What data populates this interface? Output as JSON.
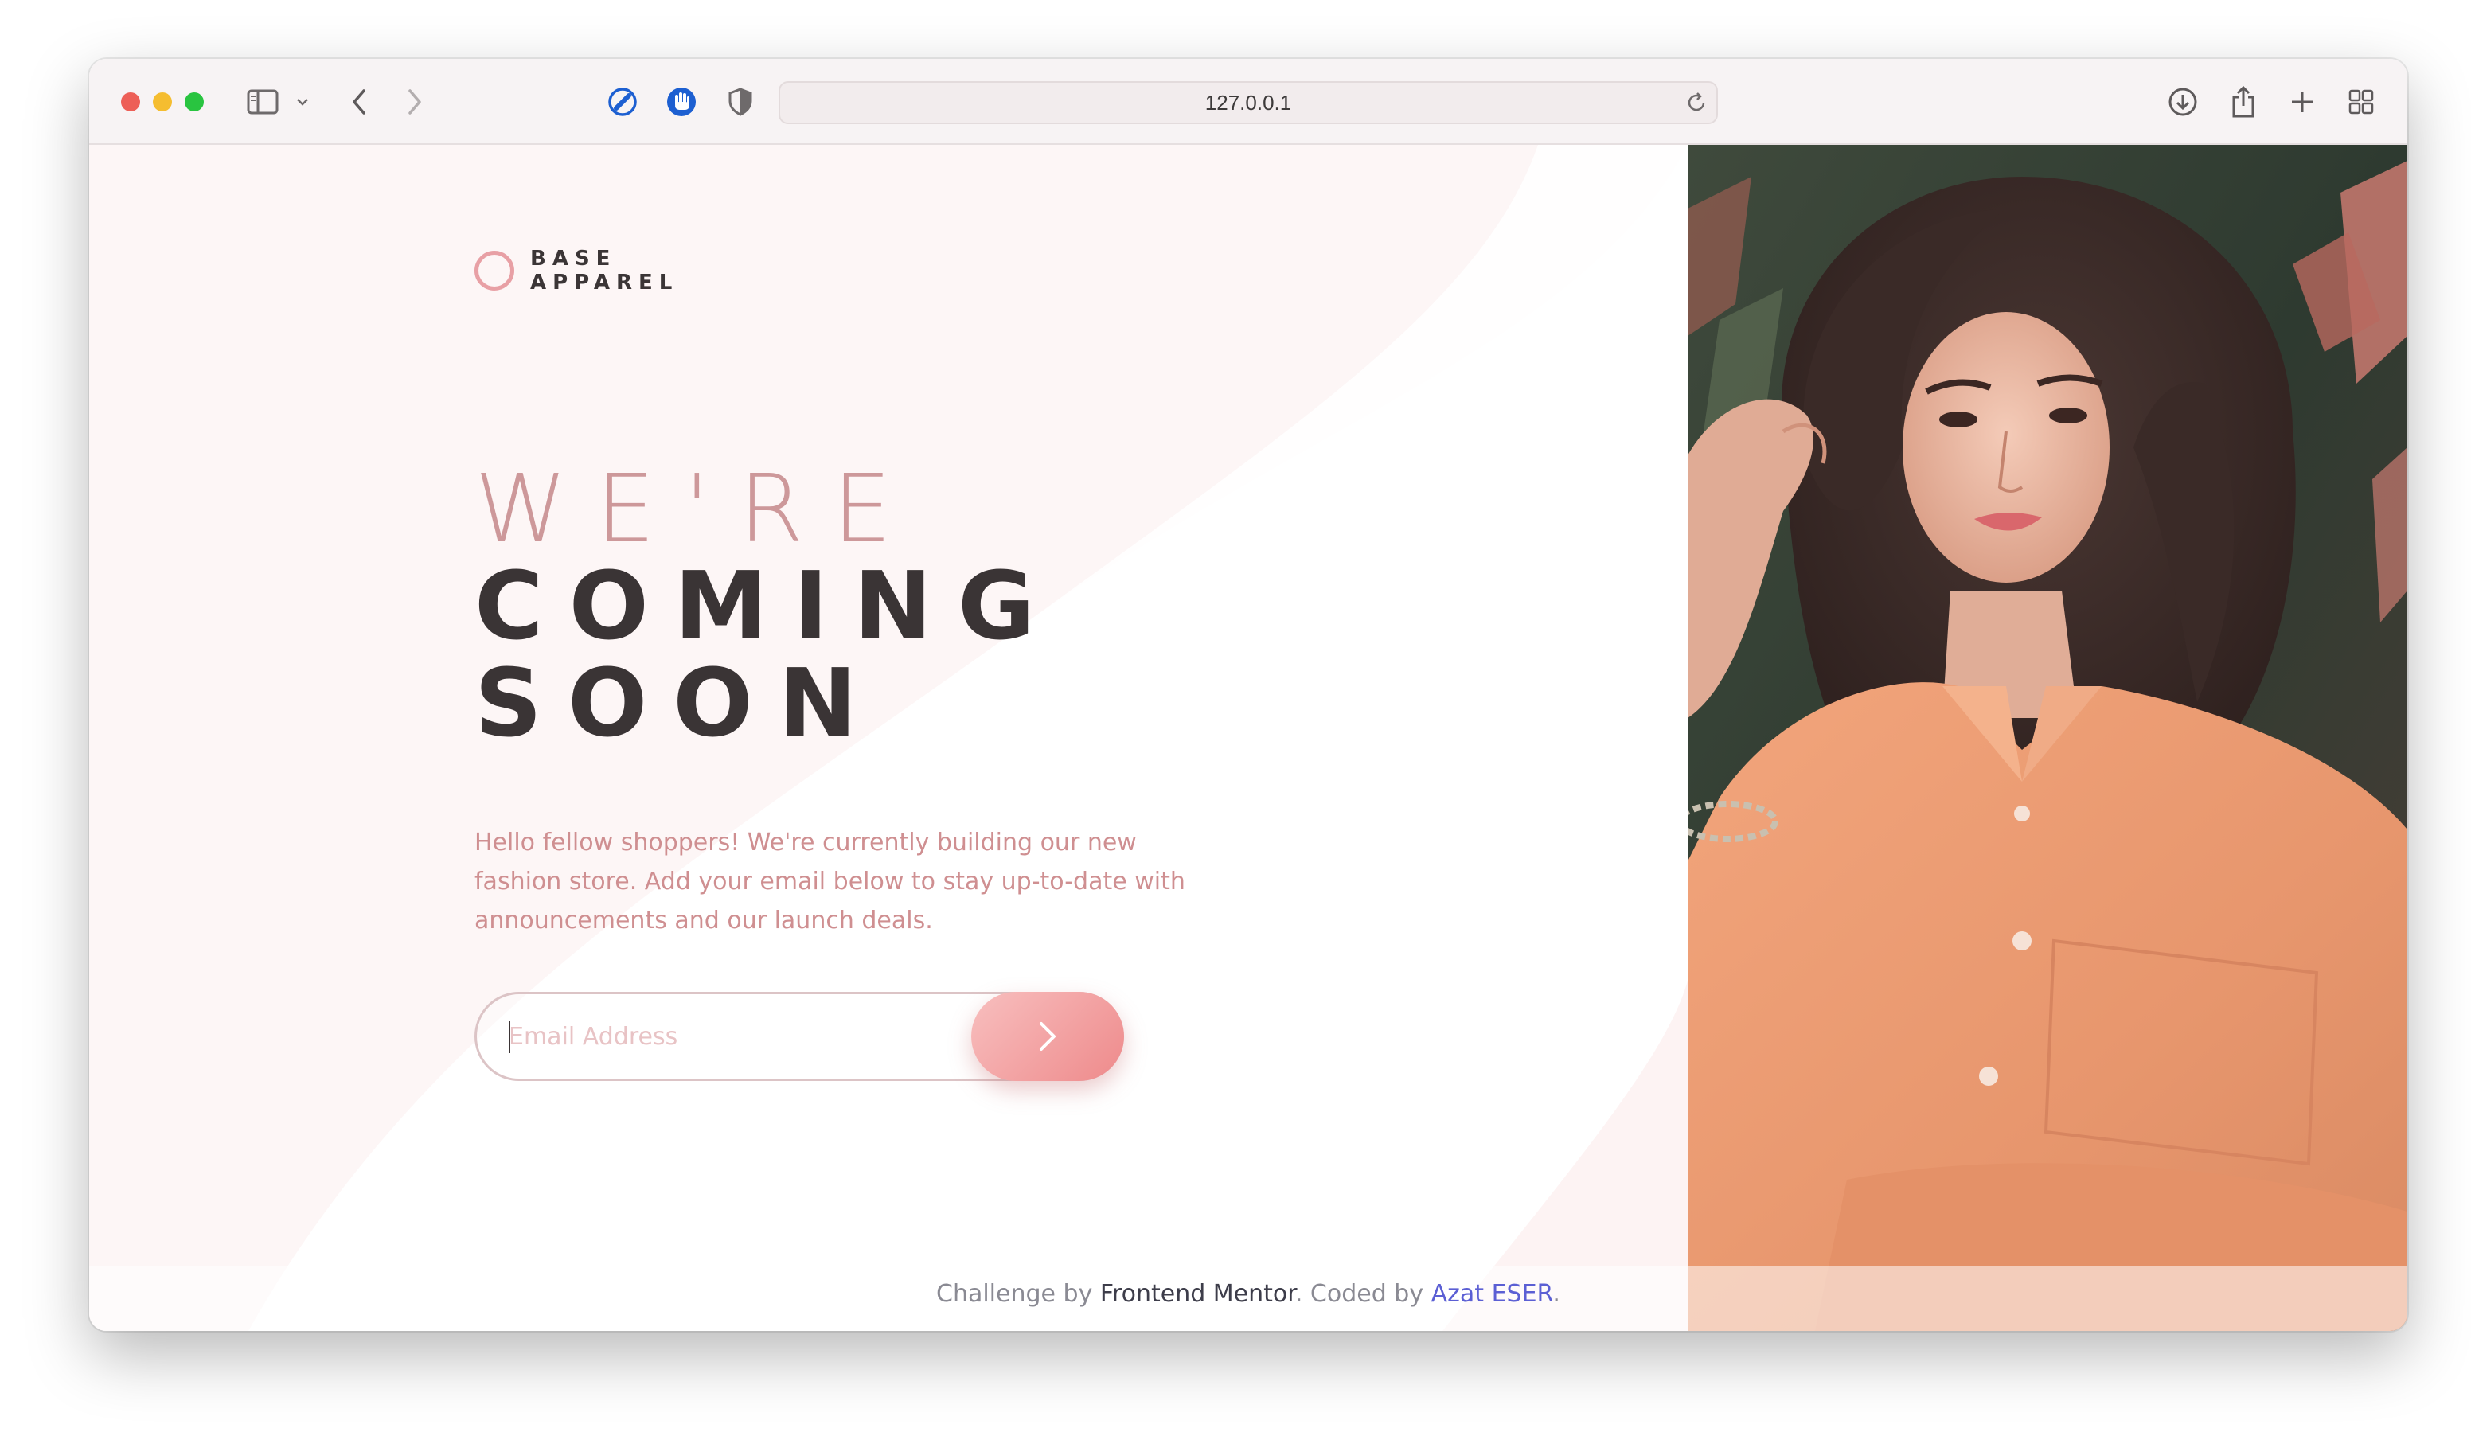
{
  "browser": {
    "url": "127.0.0.1",
    "icons": [
      "sidebar-icon",
      "chevron-down-icon",
      "back-icon",
      "forward-icon",
      "compass-icon",
      "hand-icon",
      "shield-icon",
      "reload-icon",
      "download-icon",
      "share-icon",
      "plus-icon",
      "tabs-grid-icon"
    ]
  },
  "logo": {
    "line1": "BASE",
    "line2": "APPAREL"
  },
  "hero": {
    "light": "WE'RE",
    "dark_line1": "COMING",
    "dark_line2": "SOON"
  },
  "description": {
    "line1": "Hello fellow shoppers! We're currently building our new",
    "line2": "fashion store. Add your email below to stay up-to-date with",
    "line3": "announcements and our launch deals."
  },
  "form": {
    "email_placeholder": "Email Address",
    "email_value": ""
  },
  "footer": {
    "prefix": "Challenge by ",
    "fm": "Frontend Mentor",
    "mid": ". Coded by ",
    "author": "Azat ESER",
    "suffix": "."
  },
  "colors": {
    "accent": "#ce9797",
    "dark": "#423a3a",
    "author_link": "#5b5fd4"
  }
}
